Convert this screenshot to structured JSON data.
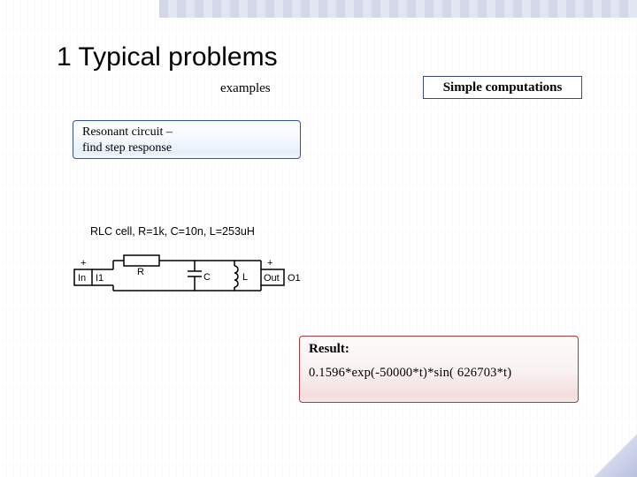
{
  "title": "1 Typical problems",
  "subtitle": "examples",
  "simpleBox": "Simple computations",
  "problem": {
    "line1": "Resonant circuit –",
    "line2": "find step response"
  },
  "circuit": {
    "heading": "RLC cell, R=1k, C=10n, L=253uH",
    "in": {
      "plus": "+",
      "port": "In",
      "name": "I1"
    },
    "r": "R",
    "c": "C",
    "l": "L",
    "out": {
      "plus": "+",
      "port": "Out",
      "name": "O1"
    }
  },
  "result": {
    "label": "Result:",
    "expr": "0.1596*exp(-50000*t)*sin( 626703*t)"
  }
}
